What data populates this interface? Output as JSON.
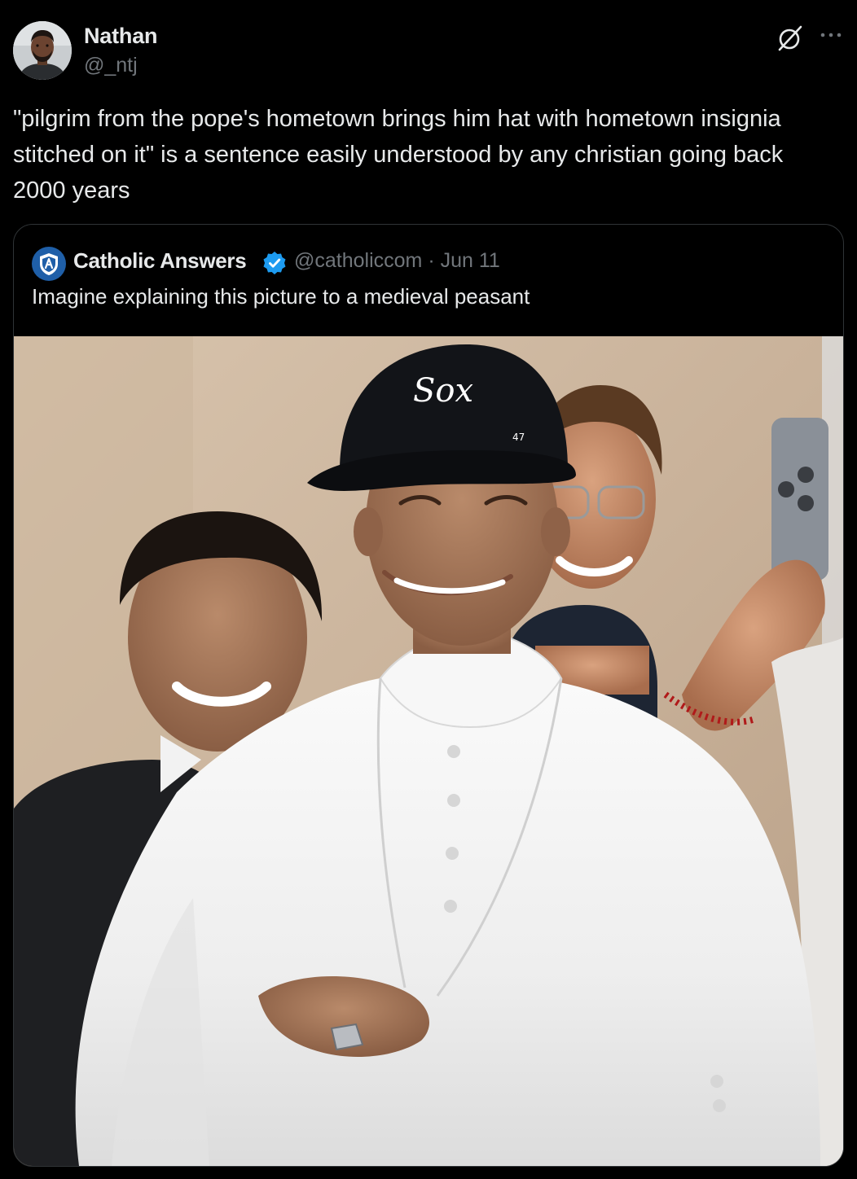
{
  "post": {
    "author": {
      "name": "Nathan",
      "handle": "@_ntj",
      "avatar_icon": "avatar-photo"
    },
    "text": "\"pilgrim from the pope's hometown brings him hat with hometown insignia stitched on it\" is a sentence easily understood by any christian going back 2000 years",
    "actions": {
      "grok_icon": "grok-slash-circle-icon",
      "more_icon": "more-horizontal-icon"
    }
  },
  "quote": {
    "author": {
      "name": "Catholic Answers",
      "handle": "@catholiccom",
      "separator": "·",
      "date": "Jun 11",
      "verified": true,
      "avatar_icon": "catholic-answers-shield-logo"
    },
    "text": "Imagine explaining this picture to a medieval peasant",
    "media": {
      "type": "photo",
      "cap_logo_text": "Sox",
      "cap_brand_text": "47"
    }
  },
  "colors": {
    "background": "#000000",
    "text_primary": "#e7e9ea",
    "text_secondary": "#71767b",
    "border": "#2f3336",
    "verified_blue": "#1d9bf0",
    "brand_blue": "#1f5fa8"
  }
}
